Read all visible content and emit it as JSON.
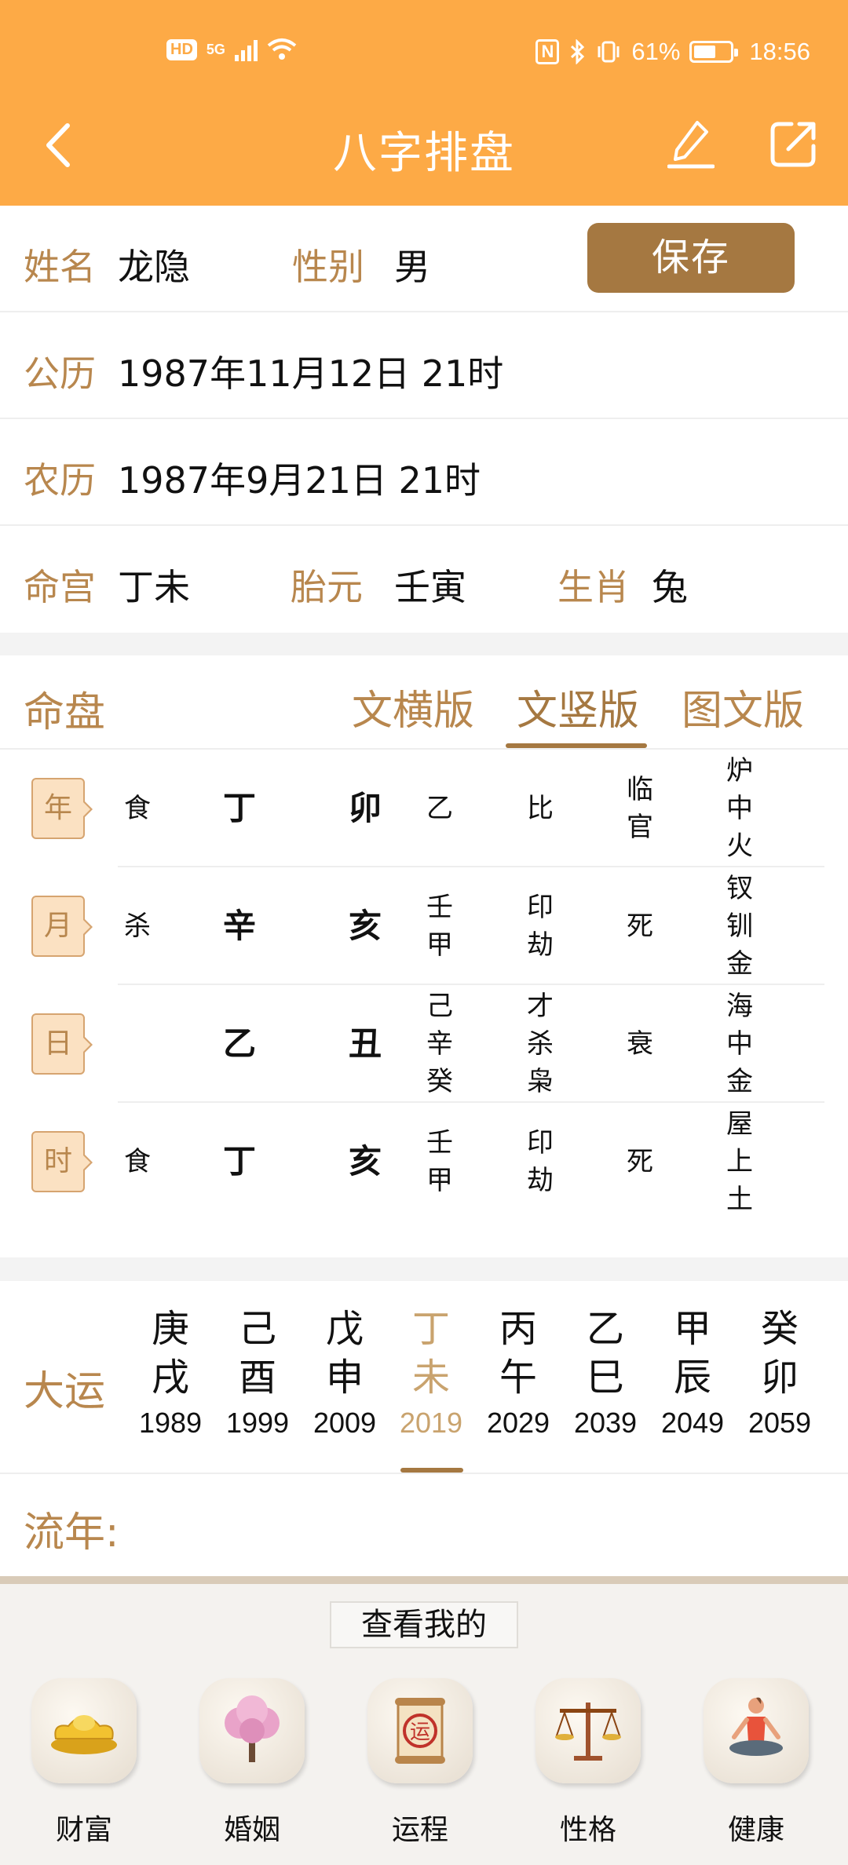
{
  "status": {
    "hd": "HD",
    "network": "5G",
    "nfc": "N",
    "battery": "61%",
    "battery_level": 0.61,
    "time": "18:56"
  },
  "nav": {
    "title": "八字排盘"
  },
  "info": {
    "name_label": "姓名",
    "name_value": "龙隐",
    "gender_label": "性别",
    "gender_value": "男",
    "save_label": "保存",
    "solar_label": "公历",
    "solar_value": "1987年11月12日 21时",
    "lunar_label": "农历",
    "lunar_value": "1987年9月21日 21时",
    "minggong_label": "命宫",
    "minggong_value": "丁未",
    "taiyuan_label": "胎元",
    "taiyuan_value": "壬寅",
    "shengxiao_label": "生肖",
    "shengxiao_value": "兔"
  },
  "chart": {
    "title": "命盘",
    "tabs": [
      "文横版",
      "文竖版",
      "图文版"
    ],
    "active_tab": "文竖版",
    "pillars": [
      {
        "tag": "年",
        "shishen": "食",
        "gan": "丁",
        "zhi": "卯",
        "canggan": [
          "乙"
        ],
        "zhishen": [
          "比"
        ],
        "state": [
          "临",
          "官"
        ],
        "nayin": [
          "炉",
          "中",
          "火"
        ]
      },
      {
        "tag": "月",
        "shishen": "杀",
        "gan": "辛",
        "zhi": "亥",
        "canggan": [
          "壬",
          "甲"
        ],
        "zhishen": [
          "印",
          "劫"
        ],
        "state": [
          "死"
        ],
        "nayin": [
          "钗",
          "钏",
          "金"
        ]
      },
      {
        "tag": "日",
        "shishen": "",
        "gan": "乙",
        "zhi": "丑",
        "canggan": [
          "己",
          "辛",
          "癸"
        ],
        "zhishen": [
          "才",
          "杀",
          "枭"
        ],
        "state": [
          "衰"
        ],
        "nayin": [
          "海",
          "中",
          "金"
        ]
      },
      {
        "tag": "时",
        "shishen": "食",
        "gan": "丁",
        "zhi": "亥",
        "canggan": [
          "壬",
          "甲"
        ],
        "zhishen": [
          "印",
          "劫"
        ],
        "state": [
          "死"
        ],
        "nayin": [
          "屋",
          "上",
          "土"
        ]
      }
    ]
  },
  "dayun": {
    "label": "大运",
    "items": [
      {
        "gan": "庚",
        "zhi": "戌",
        "year": "1989"
      },
      {
        "gan": "己",
        "zhi": "酉",
        "year": "1999"
      },
      {
        "gan": "戊",
        "zhi": "申",
        "year": "2009"
      },
      {
        "gan": "丁",
        "zhi": "未",
        "year": "2019"
      },
      {
        "gan": "丙",
        "zhi": "午",
        "year": "2029"
      },
      {
        "gan": "乙",
        "zhi": "巳",
        "year": "2039"
      },
      {
        "gan": "甲",
        "zhi": "辰",
        "year": "2049"
      },
      {
        "gan": "癸",
        "zhi": "卯",
        "year": "2059"
      }
    ],
    "active_index": 3
  },
  "liunian": {
    "label": "流年:"
  },
  "bottom": {
    "look_label": "查看我的",
    "features": [
      {
        "label": "财富",
        "icon": "gold-ingot-icon"
      },
      {
        "label": "婚姻",
        "icon": "blossom-tree-icon"
      },
      {
        "label": "运程",
        "icon": "fortune-scroll-icon"
      },
      {
        "label": "性格",
        "icon": "balance-scale-icon"
      },
      {
        "label": "健康",
        "icon": "yoga-person-icon"
      }
    ],
    "scroll_text": "运"
  },
  "colors": {
    "header": "#FDAA46",
    "label": "#B8874E",
    "accent": "#A57841",
    "active_dayun": "#C9A36E"
  }
}
